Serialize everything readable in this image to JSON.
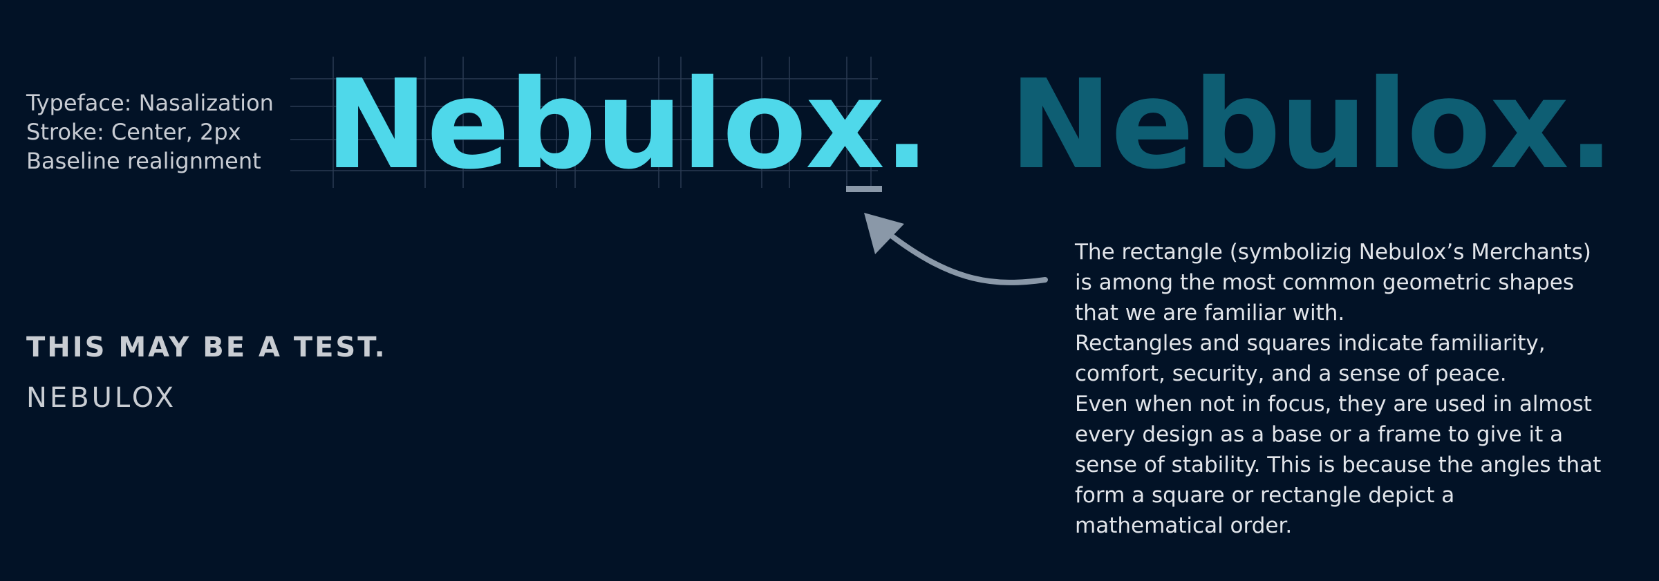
{
  "spec": {
    "typeface": "Typeface: Nasalization",
    "stroke": "Stroke: Center, 2px",
    "baseline": "Baseline realignment"
  },
  "logo": {
    "primary_text": "Nebulox.",
    "secondary_text": "Nebulox.",
    "primary_color": "#4fd8ea",
    "secondary_color": "#0e5e73"
  },
  "description": {
    "lines": [
      "The rectangle (symbolizig Nebulox’s Merchants)",
      "is among the most common geometric shapes",
      "that we are familiar with.",
      "Rectangles and squares indicate familiarity,",
      "comfort, security, and a sense of peace.",
      "Even when not in focus, they are used in almost",
      "every design as a base or a frame to give it a",
      "sense of stability. This is because the angles that",
      "form a square or rectangle depict a",
      "mathematical order."
    ]
  },
  "samples": {
    "test_line": "THIS MAY BE A TEST.",
    "brand_line": "NEBULOX"
  },
  "colors": {
    "background": "#021226",
    "grid": "#2a3a52",
    "arrow": "#8a98a8"
  }
}
